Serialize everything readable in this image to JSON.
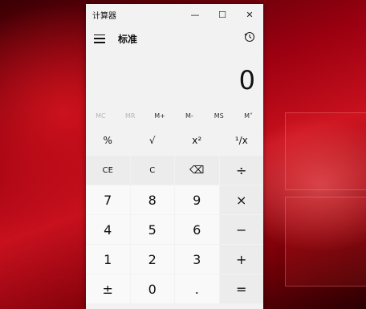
{
  "window": {
    "title": "计算器",
    "minimize": "—",
    "maximize": "☐",
    "close": "✕"
  },
  "header": {
    "mode": "标准",
    "history_icon": "history-icon"
  },
  "display": {
    "value": "0"
  },
  "memory": [
    {
      "label": "MC",
      "enabled": false
    },
    {
      "label": "MR",
      "enabled": false
    },
    {
      "label": "M+",
      "enabled": true
    },
    {
      "label": "M-",
      "enabled": true
    },
    {
      "label": "MS",
      "enabled": true
    },
    {
      "label": "M˅",
      "enabled": true
    }
  ],
  "keys": {
    "percent": "%",
    "sqrt": "√",
    "square": "x²",
    "reciprocal": "¹/x",
    "ce": "CE",
    "c": "C",
    "backspace": "⌫",
    "divide": "÷",
    "seven": "7",
    "eight": "8",
    "nine": "9",
    "multiply": "×",
    "four": "4",
    "five": "5",
    "six": "6",
    "minus": "−",
    "one": "1",
    "two": "2",
    "three": "3",
    "plus": "+",
    "negate": "±",
    "zero": "0",
    "decimal": ".",
    "equals": "="
  }
}
